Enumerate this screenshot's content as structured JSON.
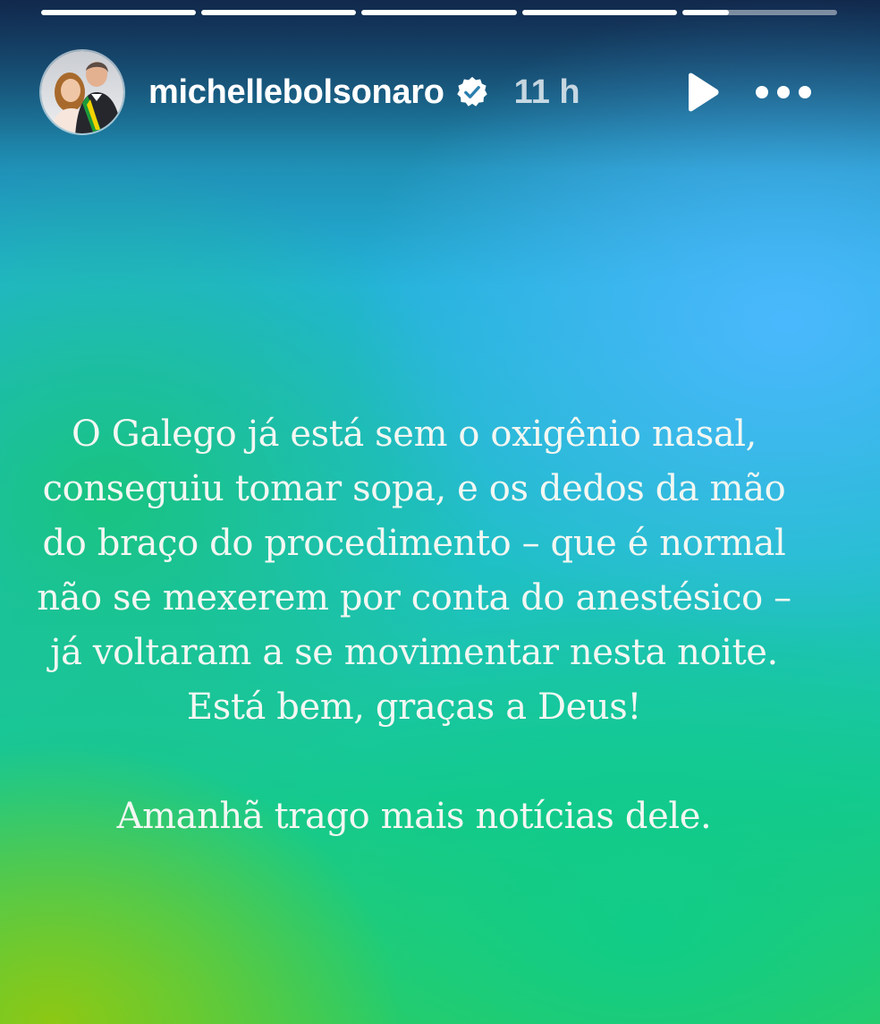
{
  "progress": {
    "segments": [
      1,
      1,
      1,
      1,
      0.3
    ]
  },
  "header": {
    "username": "michellebolsonaro",
    "verified_icon": "verified-badge-icon",
    "time": "11 h",
    "play_icon": "play-icon",
    "more_icon": "more-horizontal-icon",
    "avatar": "profile-photo"
  },
  "story": {
    "paragraph1": "O Galego já está sem o oxigênio nasal, conseguiu tomar sopa, e os dedos da mão do braço do procedimento – que é normal não se mexerem por conta do anestésico – já voltaram a se movimentar nesta noite. Está bem, graças a Deus!",
    "paragraph2": "Amanhã trago mais notícias dele."
  },
  "colors": {
    "text": "#f3f7f2",
    "gradient_blue": "#4db8ff",
    "gradient_green": "#17c98e",
    "gradient_lime": "#92c810"
  }
}
